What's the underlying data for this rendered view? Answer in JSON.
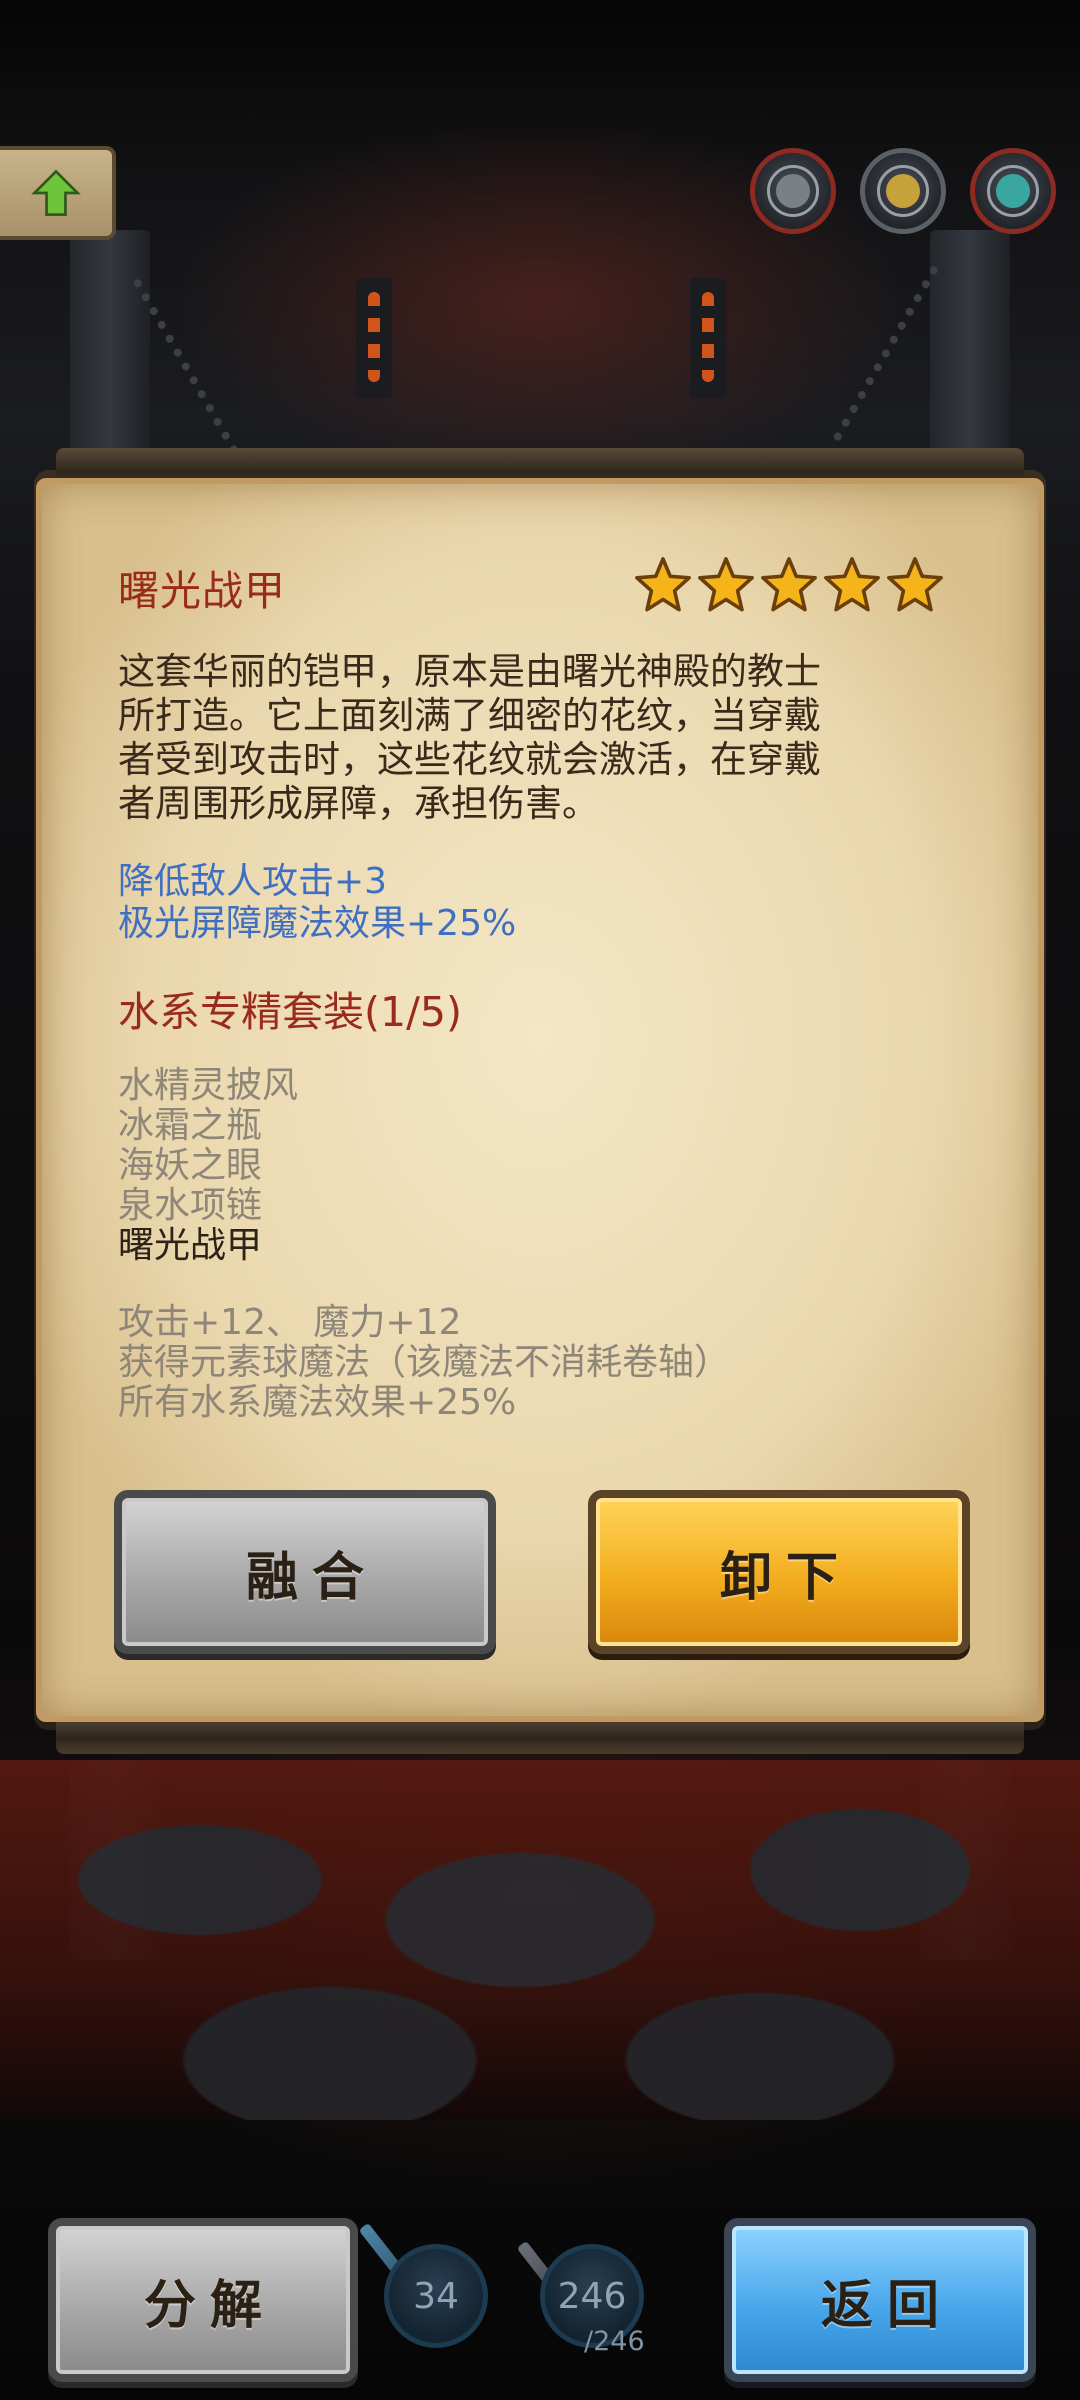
{
  "item": {
    "name": "曙光战甲",
    "stars": 5,
    "description_lines": [
      "这套华丽的铠甲，原本是由曙光神殿的教士",
      "所打造。它上面刻满了细密的花纹，当穿戴",
      "者受到攻击时，这些花纹就会激活，在穿戴",
      "者周围形成屏障，承担伤害。"
    ],
    "bonuses": [
      "降低敌人攻击+3",
      "极光屏障魔法效果+25%"
    ]
  },
  "set": {
    "title": "水系专精套装(1/5)",
    "pieces": [
      {
        "name": "水精灵披风",
        "owned": false
      },
      {
        "name": "冰霜之瓶",
        "owned": false
      },
      {
        "name": "海妖之眼",
        "owned": false
      },
      {
        "name": "泉水项链",
        "owned": false
      },
      {
        "name": "曙光战甲",
        "owned": true
      }
    ],
    "effects": [
      "攻击+12、 魔力+12",
      "获得元素球魔法（该魔法不消耗卷轴）",
      "所有水系魔法效果+25%"
    ]
  },
  "actions": {
    "fuse_label": "融合",
    "unequip_label": "卸下"
  },
  "footer": {
    "decompose_label": "分解",
    "back_label": "返回",
    "scroll_count": "34",
    "mana_current": "246",
    "mana_max": "/246"
  },
  "colors": {
    "title_red": "#9a2b1c",
    "bonus_blue": "#3f6fc2",
    "muted_gray": "#8e8678",
    "star_gold": "#f5b41a"
  },
  "icons": {
    "back_up": "up-arrow-icon",
    "star": "star-icon"
  }
}
